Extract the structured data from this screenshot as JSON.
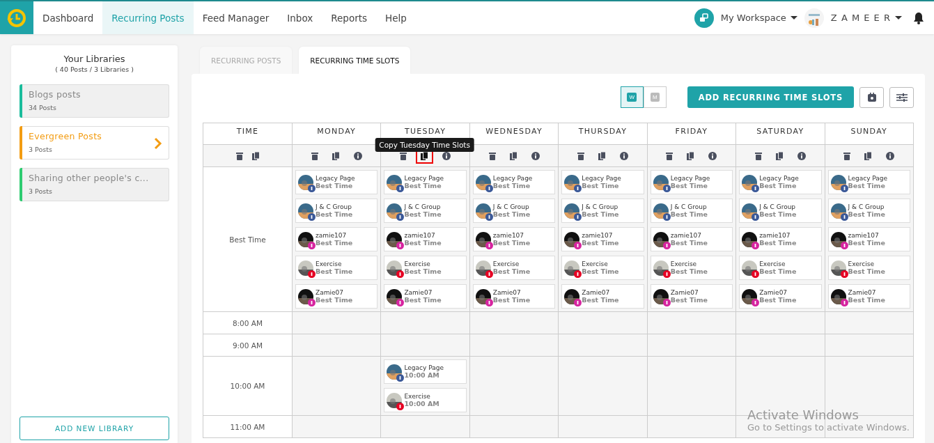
{
  "nav": {
    "items": [
      {
        "label": "Dashboard",
        "selected": false
      },
      {
        "label": "Recurring Posts",
        "selected": true
      },
      {
        "label": "Feed Manager",
        "selected": false
      },
      {
        "label": "Inbox",
        "selected": false
      },
      {
        "label": "Reports",
        "selected": false
      },
      {
        "label": "Help",
        "selected": false
      }
    ],
    "workspace": "My Workspace",
    "user": "Z A M E E R"
  },
  "libraries": {
    "title": "Your Libraries",
    "subtitle": "( 40 Posts / 3 Libraries )",
    "items": [
      {
        "name": "Blogs posts",
        "count": "34 Posts",
        "color": "#1abc9c",
        "selected": false
      },
      {
        "name": "Evergreen Posts",
        "count": "3 Posts",
        "color": "#f39c12",
        "selected": true
      },
      {
        "name": "Sharing other people's c...",
        "count": "3 Posts",
        "color": "#2ecc71",
        "selected": false
      }
    ],
    "add_button": "ADD NEW LIBRARY"
  },
  "tabs": [
    {
      "label": "RECURRING POSTS",
      "selected": false
    },
    {
      "label": "RECURRING TIME SLOTS",
      "selected": true
    }
  ],
  "toolbar": {
    "views": [
      {
        "label": "W",
        "selected": true
      },
      {
        "label": "M",
        "selected": false
      }
    ],
    "add_button": "ADD RECURRING TIME SLOTS"
  },
  "schedule": {
    "time_heading": "TIME",
    "days": [
      {
        "label": "MONDAY",
        "copy_highlighted": false
      },
      {
        "label": "TUESDAY",
        "copy_highlighted": true,
        "tooltip": "Copy Tuesday Time Slots"
      },
      {
        "label": "WEDNESDAY",
        "copy_highlighted": false
      },
      {
        "label": "THURSDAY",
        "copy_highlighted": false
      },
      {
        "label": "FRIDAY",
        "copy_highlighted": false
      },
      {
        "label": "SATURDAY",
        "copy_highlighted": false
      },
      {
        "label": "SUNDAY",
        "copy_highlighted": false
      }
    ],
    "rows": [
      {
        "time": "Best Time",
        "cells": [
          [
            {
              "account": "Legacy Page",
              "time": "Best Time",
              "kind": "facebook"
            },
            {
              "account": "J & C Group",
              "time": "Best Time",
              "kind": "facebook"
            },
            {
              "account": "zamie107",
              "time": "Best Time",
              "kind": "instagram"
            },
            {
              "account": "Exercise",
              "time": "Best Time",
              "kind": "pinterest"
            },
            {
              "account": "Zamie07",
              "time": "Best Time",
              "kind": "instagram"
            }
          ],
          [
            {
              "account": "Legacy Page",
              "time": "Best Time",
              "kind": "facebook"
            },
            {
              "account": "J & C Group",
              "time": "Best Time",
              "kind": "facebook"
            },
            {
              "account": "zamie107",
              "time": "Best Time",
              "kind": "instagram"
            },
            {
              "account": "Exercise",
              "time": "Best Time",
              "kind": "pinterest"
            },
            {
              "account": "Zamie07",
              "time": "Best Time",
              "kind": "instagram"
            }
          ],
          [
            {
              "account": "Legacy Page",
              "time": "Best Time",
              "kind": "facebook"
            },
            {
              "account": "J & C Group",
              "time": "Best Time",
              "kind": "facebook"
            },
            {
              "account": "zamie107",
              "time": "Best Time",
              "kind": "instagram"
            },
            {
              "account": "Exercise",
              "time": "Best Time",
              "kind": "pinterest"
            },
            {
              "account": "Zamie07",
              "time": "Best Time",
              "kind": "instagram"
            }
          ],
          [
            {
              "account": "Legacy Page",
              "time": "Best Time",
              "kind": "facebook"
            },
            {
              "account": "J & C Group",
              "time": "Best Time",
              "kind": "facebook"
            },
            {
              "account": "zamie107",
              "time": "Best Time",
              "kind": "instagram"
            },
            {
              "account": "Exercise",
              "time": "Best Time",
              "kind": "pinterest"
            },
            {
              "account": "Zamie07",
              "time": "Best Time",
              "kind": "instagram"
            }
          ],
          [
            {
              "account": "Legacy Page",
              "time": "Best Time",
              "kind": "facebook"
            },
            {
              "account": "J & C Group",
              "time": "Best Time",
              "kind": "facebook"
            },
            {
              "account": "zamie107",
              "time": "Best Time",
              "kind": "instagram"
            },
            {
              "account": "Exercise",
              "time": "Best Time",
              "kind": "pinterest"
            },
            {
              "account": "Zamie07",
              "time": "Best Time",
              "kind": "instagram"
            }
          ],
          [
            {
              "account": "Legacy Page",
              "time": "Best Time",
              "kind": "facebook"
            },
            {
              "account": "J & C Group",
              "time": "Best Time",
              "kind": "facebook"
            },
            {
              "account": "zamie107",
              "time": "Best Time",
              "kind": "instagram"
            },
            {
              "account": "Exercise",
              "time": "Best Time",
              "kind": "pinterest"
            },
            {
              "account": "Zamie07",
              "time": "Best Time",
              "kind": "instagram"
            }
          ],
          [
            {
              "account": "Legacy Page",
              "time": "Best Time",
              "kind": "facebook"
            },
            {
              "account": "J & C Group",
              "time": "Best Time",
              "kind": "facebook"
            },
            {
              "account": "zamie107",
              "time": "Best Time",
              "kind": "instagram"
            },
            {
              "account": "Exercise",
              "time": "Best Time",
              "kind": "pinterest"
            },
            {
              "account": "Zamie07",
              "time": "Best Time",
              "kind": "instagram"
            }
          ]
        ]
      },
      {
        "time": "8:00 AM",
        "cells": [
          [],
          [],
          [],
          [],
          [],
          [],
          []
        ]
      },
      {
        "time": "9:00 AM",
        "cells": [
          [],
          [],
          [],
          [],
          [],
          [],
          []
        ]
      },
      {
        "time": "10:00 AM",
        "cells": [
          [],
          [
            {
              "account": "Legacy Page",
              "time": "10:00 AM",
              "kind": "facebook"
            },
            {
              "account": "Exercise",
              "time": "10:00 AM",
              "kind": "pinterest"
            }
          ],
          [],
          [],
          [],
          [],
          []
        ]
      },
      {
        "time": "11:00 AM",
        "cells": [
          [],
          [],
          [],
          [],
          [],
          [],
          []
        ]
      }
    ]
  },
  "os_notice": {
    "title": "Activate Windows",
    "text": "Go to Settings to activate Windows."
  }
}
